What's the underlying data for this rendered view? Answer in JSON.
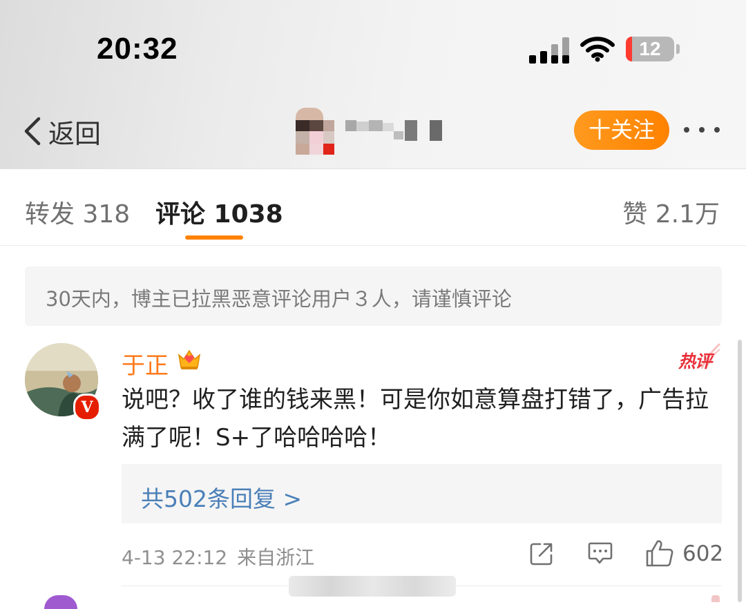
{
  "status_bar": {
    "time": "20:32",
    "battery": "12"
  },
  "nav": {
    "back_label": "返回",
    "follow_label": "十关注"
  },
  "tabs": {
    "repost": "转发 318",
    "comments": "评论 1038",
    "likes": "赞 2.1万"
  },
  "notice": "30天内，博主已拉黑恶意评论用户３人，请谨慎评论",
  "comment": {
    "username": "于正",
    "hot_label": "热评",
    "text": "说吧？收了谁的钱来黑！可是你如意算盘打错了，广告拉满了呢！S+了哈哈哈哈！",
    "replies_label": "共502条回复 >",
    "time": "4-13 22:12",
    "location": "来自浙江",
    "like_count": "602"
  },
  "colors": {
    "accent": "#ff8200",
    "link": "#4a7fb8",
    "hot": "#e8303a",
    "verified": "#e61e00"
  },
  "icons": [
    "chevron-left-icon",
    "signal-icon",
    "wifi-icon",
    "battery-icon",
    "more-icon",
    "crown-icon",
    "share-icon",
    "comment-icon",
    "like-icon"
  ]
}
